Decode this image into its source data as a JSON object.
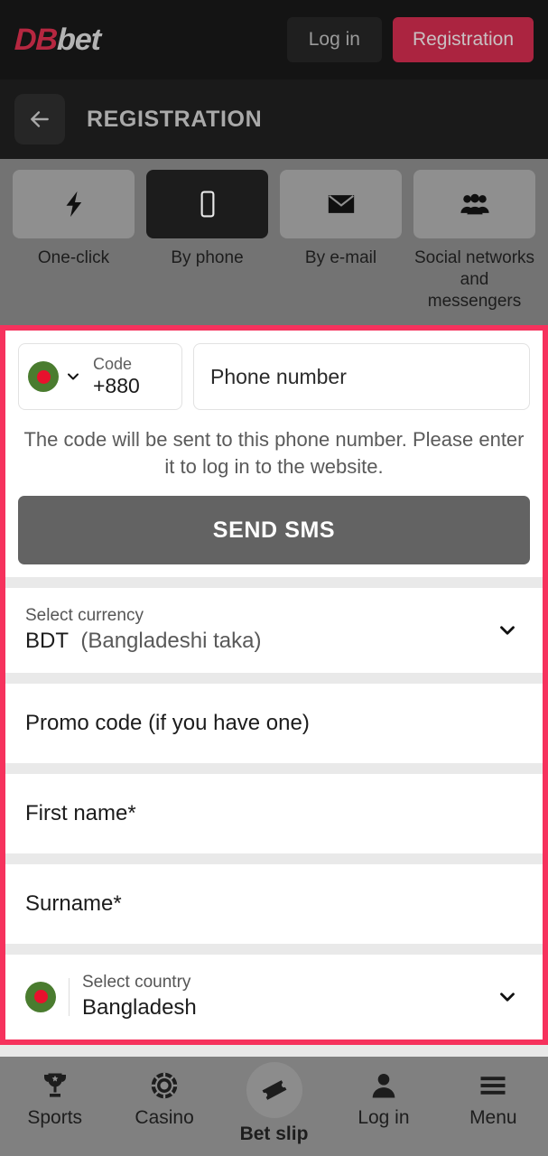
{
  "header": {
    "logo_db": "DB",
    "logo_bet": "bet",
    "login_label": "Log in",
    "registration_label": "Registration",
    "registration_color": "#ab2440"
  },
  "subheader": {
    "back_icon": "arrow-left-icon",
    "title": "REGISTRATION"
  },
  "tabs": [
    {
      "label": "One-click",
      "icon": "lightning-bolt-icon",
      "active": false
    },
    {
      "label": "By phone",
      "icon": "mobile-phone-icon",
      "active": true
    },
    {
      "label": "By e-mail",
      "icon": "envelope-icon",
      "active": false
    },
    {
      "label": "Social networks and messengers",
      "icon": "people-group-icon",
      "active": false
    }
  ],
  "form": {
    "highlight_color": "#f6325d",
    "phone": {
      "flag": "bangladesh-flag-icon",
      "code_label": "Code",
      "code_value": "+880",
      "chevron_icon": "chevron-down-icon",
      "phone_placeholder": "Phone number"
    },
    "hint": "The code will be sent to this phone number. Please enter it to log in to the website.",
    "send_sms_label": "SEND SMS",
    "currency": {
      "label": "Select currency",
      "code": "BDT",
      "name": "(Bangladeshi taka)",
      "chevron_icon": "chevron-down-icon"
    },
    "promo_placeholder": "Promo code (if you have one)",
    "first_name_placeholder": "First name*",
    "surname_placeholder": "Surname*",
    "country": {
      "flag": "bangladesh-flag-icon",
      "label": "Select country",
      "value": "Bangladesh",
      "chevron_icon": "chevron-down-icon"
    }
  },
  "bottom_nav": [
    {
      "label": "Sports",
      "icon": "trophy-icon"
    },
    {
      "label": "Casino",
      "icon": "casino-chip-icon"
    },
    {
      "label": "Bet slip",
      "icon": "bet-ticket-icon"
    },
    {
      "label": "Log in",
      "icon": "person-icon"
    },
    {
      "label": "Menu",
      "icon": "hamburger-menu-icon"
    }
  ]
}
